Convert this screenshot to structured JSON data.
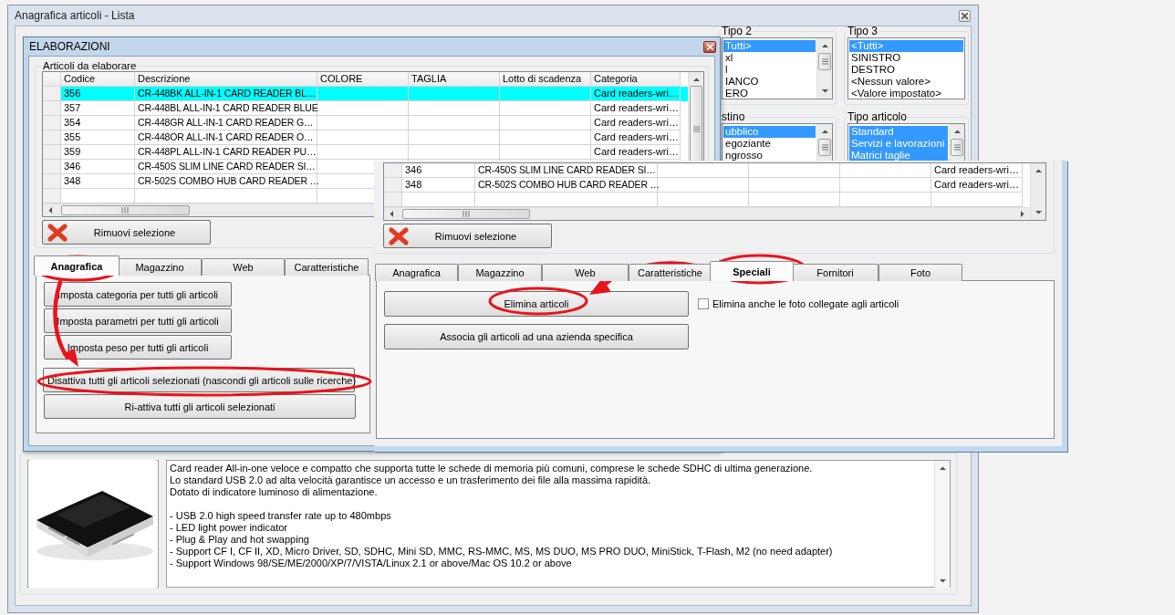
{
  "main_window": {
    "title": "Anagrafica articoli  - Lista"
  },
  "filters": [
    {
      "label": "Tipo 2",
      "items": [
        {
          "text": "Tutti>",
          "selected": true
        },
        {
          "text": "xl",
          "selected": false
        },
        {
          "text": "l",
          "selected": false
        },
        {
          "text": "IANCO",
          "selected": false
        },
        {
          "text": "ERO",
          "selected": false
        }
      ]
    },
    {
      "label": "Tipo 3",
      "items": [
        {
          "text": "<Tutti>",
          "selected": true
        },
        {
          "text": "SINISTRO",
          "selected": false
        },
        {
          "text": "DESTRO",
          "selected": false
        },
        {
          "text": "<Nessun valore>",
          "selected": false
        },
        {
          "text": "<Valore impostato>",
          "selected": false
        }
      ]
    },
    {
      "label": "stino",
      "items": [
        {
          "text": "ubblico",
          "selected": true
        },
        {
          "text": "egoziante",
          "selected": false
        },
        {
          "text": "ngrosso",
          "selected": false
        }
      ]
    },
    {
      "label": "Tipo articolo",
      "items": [
        {
          "text": "Standard",
          "selected": true
        },
        {
          "text": "Servizi e lavorazioni",
          "selected": true
        },
        {
          "text": "Matrici taglie",
          "selected": true
        }
      ]
    }
  ],
  "dialog": {
    "title": "ELABORAZIONI",
    "group_label": "Articoli da elaborare",
    "columns": [
      "Codice",
      "Descrizione",
      "COLORE",
      "TAGLIA",
      "Lotto di scadenza",
      "Categoria"
    ],
    "rows": [
      {
        "code": "356",
        "description": "CR-448BK ALL-IN-1 CARD READER BL…",
        "category": "Card readers-wri…",
        "selected": true
      },
      {
        "code": "357",
        "description": "CR-448BL ALL-IN-1 CARD READER BLUE",
        "category": "Card readers-wri…",
        "selected": false
      },
      {
        "code": "354",
        "description": "CR-448GR ALL-IN-1 CARD READER G…",
        "category": "Card readers-wri…",
        "selected": false
      },
      {
        "code": "355",
        "description": "CR-448OR ALL-IN-1 CARD READER O…",
        "category": "Card readers-wri…",
        "selected": false
      },
      {
        "code": "359",
        "description": "CR-448PL ALL-IN-1 CARD READER PU…",
        "category": "Card readers-wri…",
        "selected": false
      },
      {
        "code": "346",
        "description": "CR-450S SLIM LINE CARD READER SI…",
        "selected": false
      },
      {
        "code": "348",
        "description": "CR-502S COMBO HUB CARD READER …",
        "selected": false
      }
    ],
    "remove_button": "Rimuovi selezione",
    "tabs": [
      {
        "label": "Anagrafica",
        "selected": true
      },
      {
        "label": "Magazzino",
        "selected": false
      },
      {
        "label": "Web",
        "selected": false
      },
      {
        "label": "Caratteristiche",
        "selected": false
      }
    ],
    "actions": [
      "Imposta categoria per tutti gli articoli",
      "Imposta parametri per tutti gli articoli",
      "Imposta peso per tutti gli articoli",
      "Disattiva tutti gli articoli selezionati (nascondi gli articoli sulle ricerche)",
      "Ri-attiva tutti gli articoli selezionati"
    ]
  },
  "overlay": {
    "rows": [
      {
        "code": "346",
        "description": "CR-450S SLIM LINE CARD READER SI…",
        "category": "Card readers-wri…",
        "selected": false
      },
      {
        "code": "348",
        "description": "CR-502S COMBO HUB CARD READER …",
        "category": "Card readers-wri…",
        "selected": false
      }
    ],
    "remove_button": "Rimuovi selezione",
    "tabs": [
      {
        "label": "Anagrafica",
        "selected": false
      },
      {
        "label": "Magazzino",
        "selected": false
      },
      {
        "label": "Web",
        "selected": false
      },
      {
        "label": "Caratteristiche",
        "selected": false
      },
      {
        "label": "Speciali",
        "selected": true
      },
      {
        "label": "Fornitori",
        "selected": false
      },
      {
        "label": "Foto",
        "selected": false
      }
    ],
    "actions": [
      "Elimina articoli",
      "Associa gli articoli ad una azienda specifica"
    ],
    "checkbox": {
      "label": "Elimina anche le foto collegate agli articoli",
      "checked": false
    }
  },
  "product": {
    "picture": {
      "kind": "picture"
    },
    "description": [
      [
        "Card reader All-in-one veloce e compatto che supporta tutte le schede di memoria più comuni, comprese le schede SDHC di ultima generazione.",
        "Lo standard USB 2.0 ad alta velocità garantisce un accesso e un trasferimento dei file alla massima rapidità.",
        "Dotato di indicatore luminoso di alimentazione."
      ],
      [
        "- USB 2.0 high speed transfer rate up to 480mbps",
        "- LED light power indicator",
        "- Plug & Play and hot swapping",
        "- Support CF I, CF II, XD, Micro Driver, SD, SDHC, Mini SD, MMC, RS-MMC, MS, MS DUO, MS PRO DUO, MiniStick, T-Flash, M2 (no need adapter)",
        "- Support Windows 98/SE/ME/2000/XP/7/VISTA/Linux 2.1 or above/Mac OS 10.2 or above"
      ]
    ]
  }
}
